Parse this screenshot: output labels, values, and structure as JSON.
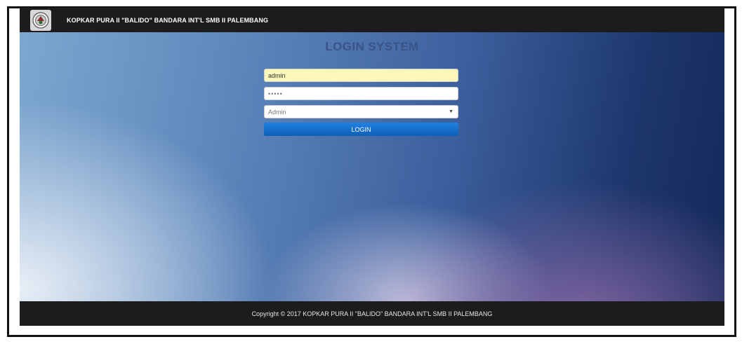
{
  "header": {
    "brand": "KOPKAR PURA II \"BALIDO\" BANDARA INT'L SMB II PALEMBANG"
  },
  "login": {
    "title": "LOGIN SYSTEM",
    "username_value": "admin",
    "password_mask": "•••••",
    "role_selected": "Admin",
    "submit_label": "LOGIN"
  },
  "footer": {
    "copyright": "Copyright © 2017 KOPKAR PURA II \"BALIDO\" BANDARA INT'L SMB II PALEMBANG"
  },
  "icons": {
    "logo": "emblem-logo-icon",
    "select_caret": "caret-down-icon"
  },
  "colors": {
    "nav_bg": "#1c1c1c",
    "title": "#3a5488",
    "username_bg": "#fbf7b8",
    "button": "#1f82e0"
  }
}
